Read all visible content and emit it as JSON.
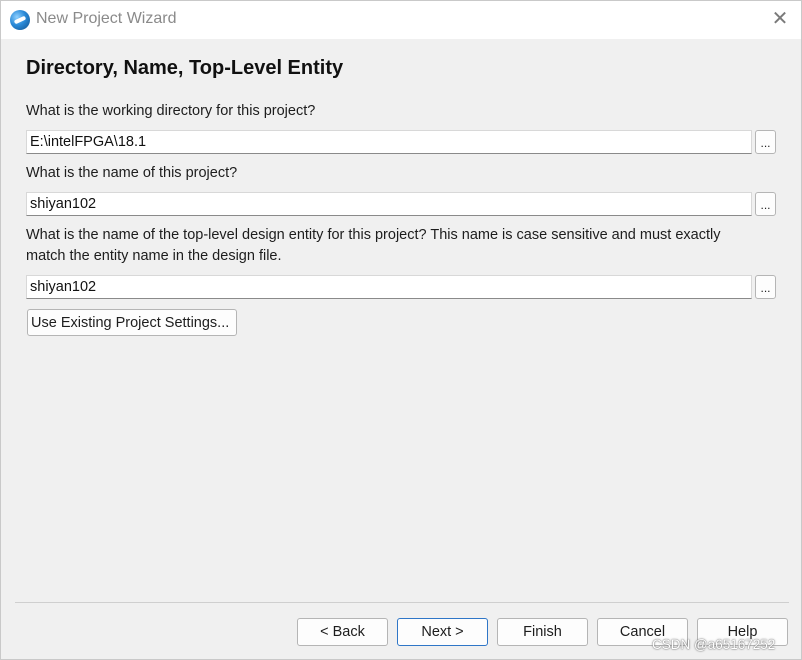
{
  "window": {
    "title": "New Project Wizard"
  },
  "page": {
    "heading": "Directory, Name, Top-Level Entity"
  },
  "directory": {
    "question": "What is the working directory for this project?",
    "value": "E:\\intelFPGA\\18.1",
    "browse_label": "..."
  },
  "project_name": {
    "question": "What is the name of this project?",
    "value": "shiyan102",
    "browse_label": "..."
  },
  "top_entity": {
    "question_line1": "What is the name of the top-level design entity for this project? This name is case sensitive and must exactly",
    "question_line2": "match the entity name in the design file.",
    "value": "shiyan102",
    "browse_label": "..."
  },
  "existing_settings_label": "Use Existing Project Settings...",
  "buttons": {
    "back": "< Back",
    "next": "Next >",
    "finish": "Finish",
    "cancel": "Cancel",
    "help": "Help"
  },
  "watermark": "CSDN @a65167252",
  "colors": {
    "primary_border": "#2f76c7",
    "background": "#f0f0f0"
  },
  "icons": {
    "app": "quartus-globe-icon",
    "close": "close-icon"
  }
}
